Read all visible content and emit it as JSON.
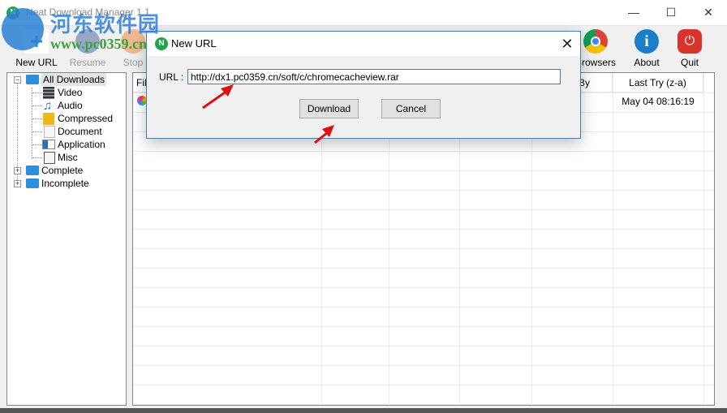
{
  "window": {
    "title": "Neat Download Manager 1.1",
    "minimize": "—",
    "maximize": "☐",
    "close": "✕"
  },
  "toolbar": [
    {
      "label": "New URL",
      "icon": "new-url-icon",
      "enabled": true
    },
    {
      "label": "Resume",
      "icon": "resume-icon",
      "enabled": false
    },
    {
      "label": "Stop",
      "icon": "stop-icon",
      "enabled": false
    },
    {
      "label": "Browsers",
      "icon": "chrome-icon",
      "enabled": true
    },
    {
      "label": "About",
      "icon": "info-icon",
      "enabled": true
    },
    {
      "label": "Quit",
      "icon": "power-icon",
      "enabled": true
    }
  ],
  "tree": {
    "all": "All Downloads",
    "children": [
      "Video",
      "Audio",
      "Compressed",
      "Document",
      "Application",
      "Misc"
    ],
    "complete": "Complete",
    "incomplete": "Incomplete"
  },
  "list": {
    "headers": {
      "file": "File",
      "by": "By",
      "last_try": "Last Try (z-a)"
    },
    "rows": [
      {
        "last_try": "May 04  08:16:19"
      }
    ]
  },
  "dialog": {
    "title": "New URL",
    "close": "✕",
    "url_label": "URL :",
    "url_value": "http://dx1.pc0359.cn/soft/c/chromecacheview.rar",
    "download": "Download",
    "cancel": "Cancel"
  },
  "watermark": {
    "text": "河东软件园",
    "url": "www.pc0359.cn"
  },
  "colors": {
    "accent": "#2f8fdc",
    "dialog_border": "#4a7eb0",
    "arrow": "#e01010"
  }
}
